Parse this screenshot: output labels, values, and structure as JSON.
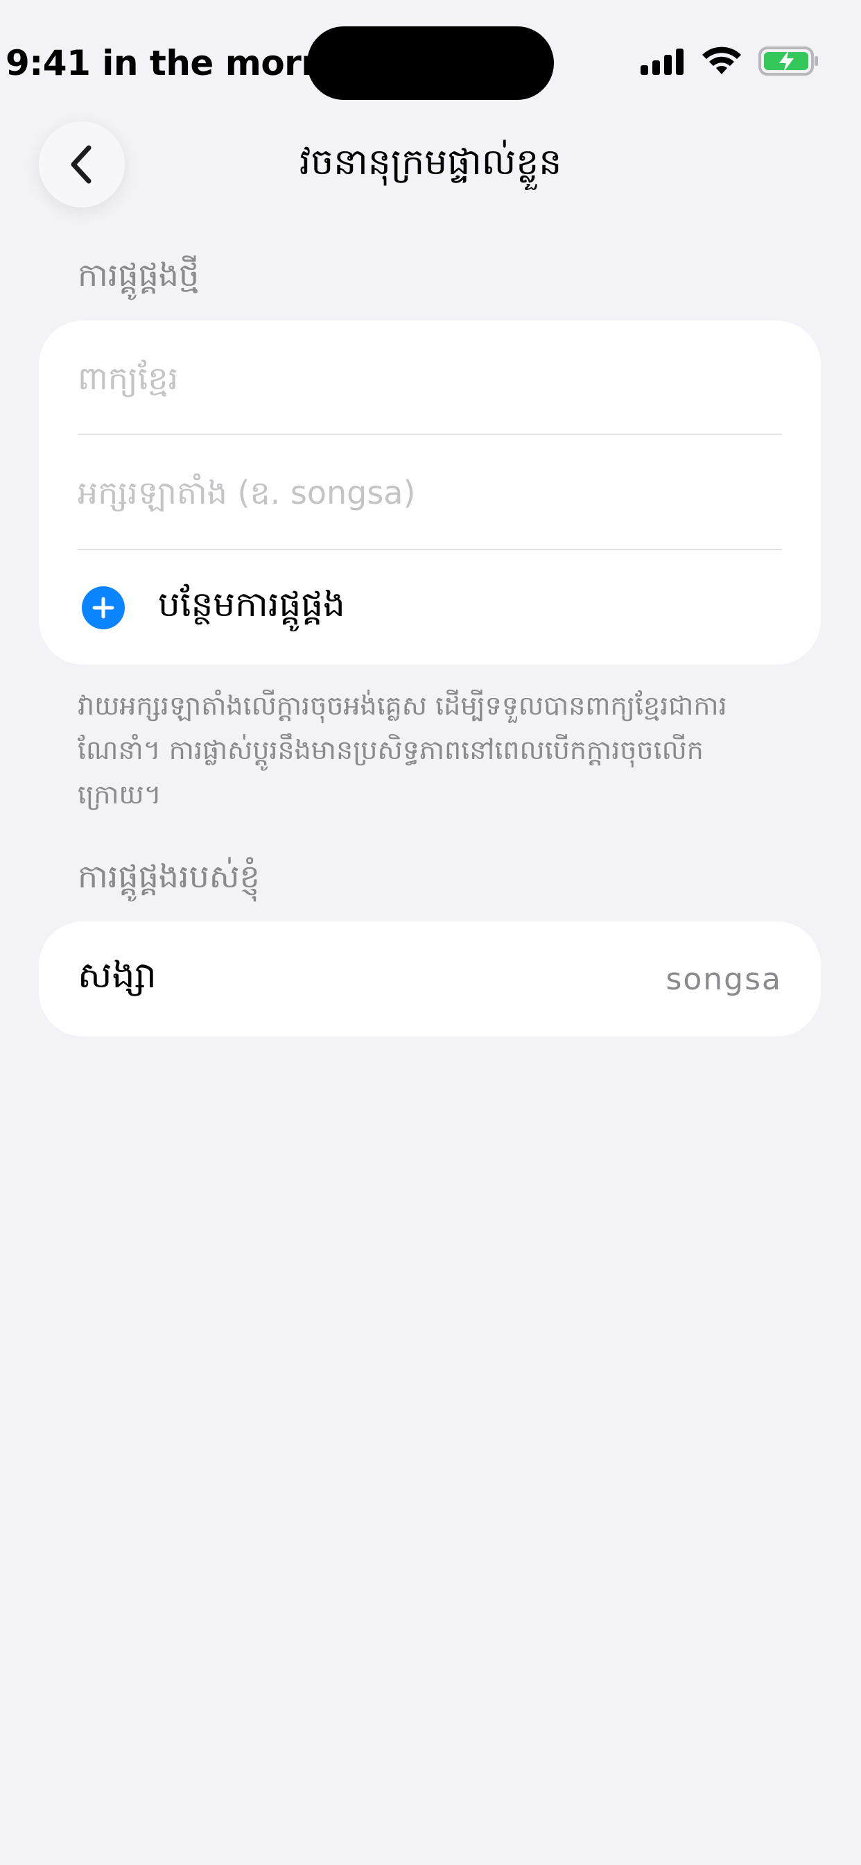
{
  "status_bar": {
    "time": "9:41 in the morning"
  },
  "nav": {
    "title": "វចនានុក្រមផ្ទាល់ខ្លួន",
    "back_icon": "chevron-left-icon"
  },
  "new_shortcut": {
    "header": "ការផ្គូផ្គងថ្មី",
    "phrase_placeholder": "ពាក្យខ្មែរ",
    "input_placeholder": "អក្សរឡាតាំង (ឧ. songsa)",
    "add_label": "បន្ថែមការផ្គូផ្គង",
    "add_icon": "plus-circle-icon",
    "note": "វាយអក្សរឡាតាំងលើក្តារចុចអង់គ្លេស ដើម្បីទទួលបានពាក្យខ្មែរជាការណែនាំ។ ការផ្លាស់ប្ដូរនឹងមានប្រសិទ្ធភាពនៅពេលបើកក្ដារចុចលើកក្រោយ។"
  },
  "my_shortcuts": {
    "header": "ការផ្គូផ្គងរបស់ខ្ញុំ",
    "items": [
      {
        "phrase": "សង្សា",
        "input": "songsa"
      }
    ]
  },
  "colors": {
    "background": "#f2f2f7",
    "card": "#ffffff",
    "accent": "#0a84ff",
    "secondary_text": "#8a8a8e",
    "placeholder": "#c4c4c7",
    "battery": "#34c759"
  }
}
